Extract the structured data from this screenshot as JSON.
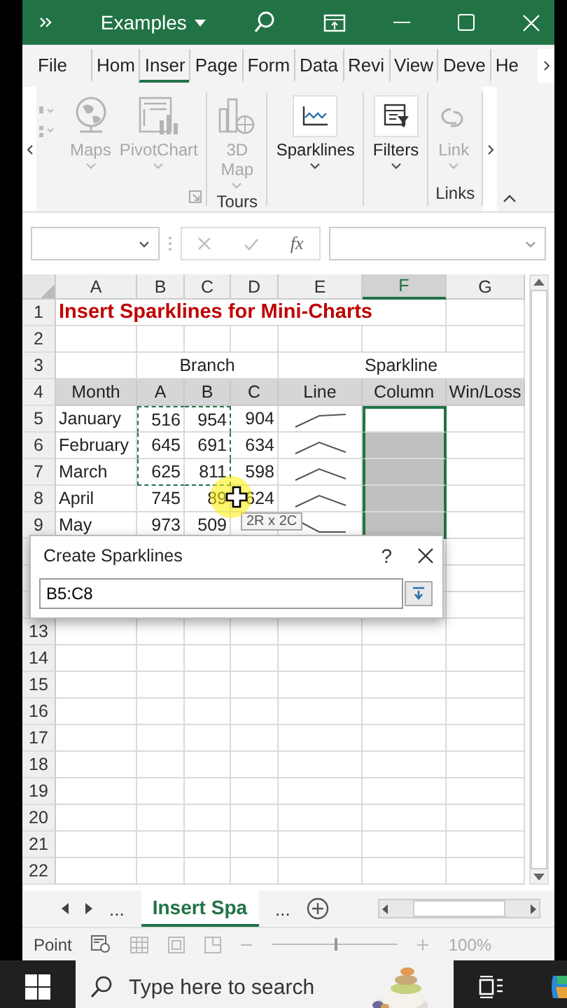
{
  "title_bar": {
    "title": "Examples"
  },
  "ribbon_tabs": [
    {
      "label": "File",
      "selected": false
    },
    {
      "label": "Hom",
      "selected": false
    },
    {
      "label": "Inser",
      "selected": true
    },
    {
      "label": "Page",
      "selected": false
    },
    {
      "label": "Form",
      "selected": false
    },
    {
      "label": "Data",
      "selected": false
    },
    {
      "label": "Revi",
      "selected": false
    },
    {
      "label": "View",
      "selected": false
    },
    {
      "label": "Deve",
      "selected": false
    },
    {
      "label": "He",
      "selected": false
    }
  ],
  "ribbon": {
    "groups": [
      {
        "buttons": [
          {
            "kind": "maps",
            "label": "Maps",
            "disabled": true
          },
          {
            "kind": "pivotchart",
            "label": "PivotChart",
            "disabled": true
          }
        ]
      },
      {
        "label": "Tours",
        "buttons": [
          {
            "kind": "map3d",
            "label": "3D Map",
            "disabled": true
          }
        ]
      },
      {
        "buttons": [
          {
            "kind": "sparklines",
            "label": "Sparklines",
            "disabled": false
          }
        ]
      },
      {
        "buttons": [
          {
            "kind": "filters",
            "label": "Filters",
            "disabled": false
          }
        ]
      },
      {
        "label": "Links",
        "buttons": [
          {
            "kind": "link",
            "label": "Link",
            "disabled": true
          }
        ]
      }
    ]
  },
  "formula_bar": {
    "function_label": "fx"
  },
  "grid": {
    "columns": [
      {
        "label": "A",
        "selected": false
      },
      {
        "label": "B",
        "selected": false
      },
      {
        "label": "C",
        "selected": false
      },
      {
        "label": "D",
        "selected": false
      },
      {
        "label": "E",
        "selected": false
      },
      {
        "label": "F",
        "selected": true
      },
      {
        "label": "G",
        "selected": false
      }
    ],
    "rows": [
      {
        "number": "1",
        "kind": "plain",
        "selected": false,
        "marked": false,
        "cells": [
          {
            "kind": "title",
            "text": "Insert Sparklines for Mini-Charts"
          },
          {
            "kind": "covered"
          },
          {
            "kind": "covered"
          },
          {
            "kind": "covered"
          },
          {
            "kind": "covered"
          },
          {
            "kind": "covered"
          },
          {
            "kind": "empty"
          }
        ]
      },
      {
        "number": "2",
        "kind": "plain",
        "selected": false,
        "marked": false
      },
      {
        "number": "3",
        "kind": "plain",
        "selected": false,
        "marked": false,
        "cells": [
          {
            "kind": "empty"
          },
          {
            "kind": "heading",
            "text": "Branch"
          },
          {
            "kind": "covered"
          },
          {
            "kind": "covered"
          },
          {
            "kind": "heading",
            "text": "Sparkline"
          },
          {
            "kind": "covered"
          },
          {
            "kind": "covered"
          }
        ]
      },
      {
        "number": "4",
        "kind": "band",
        "selected": false,
        "marked": false,
        "cells": [
          {
            "kind": "heading",
            "text": "Month"
          },
          {
            "kind": "heading",
            "text": "A"
          },
          {
            "kind": "heading",
            "text": "B"
          },
          {
            "kind": "heading",
            "text": "C"
          },
          {
            "kind": "heading",
            "text": "Line"
          },
          {
            "kind": "heading",
            "text": "Column"
          },
          {
            "kind": "heading",
            "text": "Win/Loss"
          }
        ]
      },
      {
        "number": "5",
        "kind": "plain",
        "selected": true,
        "marked": true,
        "sparkline": true,
        "cells": [
          {
            "kind": "text",
            "text": "January"
          },
          {
            "kind": "number",
            "text": "516"
          },
          {
            "kind": "number",
            "text": "954"
          },
          {
            "kind": "number",
            "text": "904"
          }
        ]
      },
      {
        "number": "6",
        "kind": "plain",
        "selected": true,
        "marked": true,
        "sparkline": true,
        "cells": [
          {
            "kind": "text",
            "text": "February"
          },
          {
            "kind": "number",
            "text": "645"
          },
          {
            "kind": "number",
            "text": "691"
          },
          {
            "kind": "number",
            "text": "634"
          }
        ]
      },
      {
        "number": "7",
        "kind": "plain",
        "selected": true,
        "marked": true,
        "sparkline": true,
        "cells": [
          {
            "kind": "text",
            "text": "March"
          },
          {
            "kind": "number",
            "text": "625"
          },
          {
            "kind": "number",
            "text": "811"
          },
          {
            "kind": "number",
            "text": "598"
          }
        ]
      },
      {
        "number": "8",
        "kind": "plain",
        "selected": true,
        "marked": false,
        "sparkline": true,
        "cells": [
          {
            "kind": "text",
            "text": "April"
          },
          {
            "kind": "number",
            "text": "745"
          },
          {
            "kind": "number",
            "text": "89"
          },
          {
            "kind": "number",
            "text": "624"
          }
        ]
      },
      {
        "number": "9",
        "kind": "plain",
        "selected": true,
        "marked": false,
        "sparkline": true,
        "cells": [
          {
            "kind": "text",
            "text": "May"
          },
          {
            "kind": "number",
            "text": "973"
          },
          {
            "kind": "number",
            "text": "509"
          }
        ]
      },
      {
        "kind": "plain"
      },
      {
        "kind": "plain"
      },
      {
        "kind": "plain"
      },
      {
        "number": "13",
        "kind": "plain",
        "selected": false,
        "marked": false
      },
      {
        "number": "14",
        "kind": "plain",
        "selected": false,
        "marked": false
      },
      {
        "number": "15",
        "kind": "plain",
        "selected": false,
        "marked": false
      },
      {
        "number": "16",
        "kind": "plain",
        "selected": false,
        "marked": false
      },
      {
        "number": "17",
        "kind": "plain",
        "selected": false,
        "marked": false
      },
      {
        "number": "18",
        "kind": "plain",
        "selected": false,
        "marked": false
      },
      {
        "number": "19",
        "kind": "plain",
        "selected": false,
        "marked": false
      },
      {
        "number": "20",
        "kind": "plain",
        "selected": false,
        "marked": false
      },
      {
        "number": "21",
        "kind": "plain",
        "selected": false,
        "marked": false
      },
      {
        "number": "22",
        "kind": "plain",
        "selected": false,
        "marked": false
      }
    ]
  },
  "tooltip": "2R x 2C",
  "dialog": {
    "title": "Create Sparklines",
    "help": "?",
    "field_value": "B5:C8"
  },
  "sheet_bar": {
    "leading": "...",
    "tabs": [
      {
        "label": "Insert Spa",
        "selected": true
      }
    ],
    "trailing": "..."
  },
  "status_bar": {
    "mode": "Point",
    "zoom": {
      "level": 0.5,
      "reading": "100%"
    }
  },
  "taskbar": {
    "search": {
      "placeholder": "Type here to search"
    }
  }
}
